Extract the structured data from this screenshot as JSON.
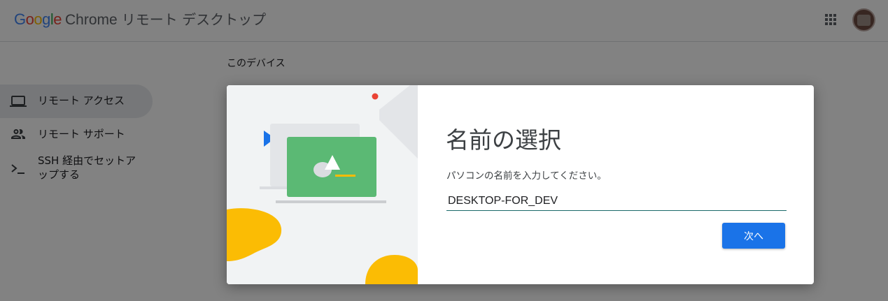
{
  "header": {
    "logo_google": "Google",
    "logo_chrome": "Chrome",
    "product_name": "リモート デスクトップ",
    "apps_icon": "apps-grid-icon",
    "avatar_icon": "account-avatar"
  },
  "sidebar": {
    "items": [
      {
        "label": "リモート アクセス",
        "icon": "laptop-icon",
        "active": true
      },
      {
        "label": "リモート サポート",
        "icon": "people-icon",
        "active": false
      },
      {
        "label_line1": "SSH 経由でセットア",
        "label_line2": "ップする",
        "icon": "terminal-icon",
        "active": false
      }
    ]
  },
  "main": {
    "section_title": "このデバイス"
  },
  "dialog": {
    "title": "名前の選択",
    "description": "パソコンの名前を入力してください。",
    "input_value": "DESKTOP-FOR_DEV",
    "next_label": "次へ"
  },
  "colors": {
    "primary_blue": "#1a73e8",
    "illustration_green": "#5bb974",
    "illustration_yellow": "#fbbc04",
    "illustration_red": "#ea4335",
    "illustration_blue": "#1a73e8"
  }
}
